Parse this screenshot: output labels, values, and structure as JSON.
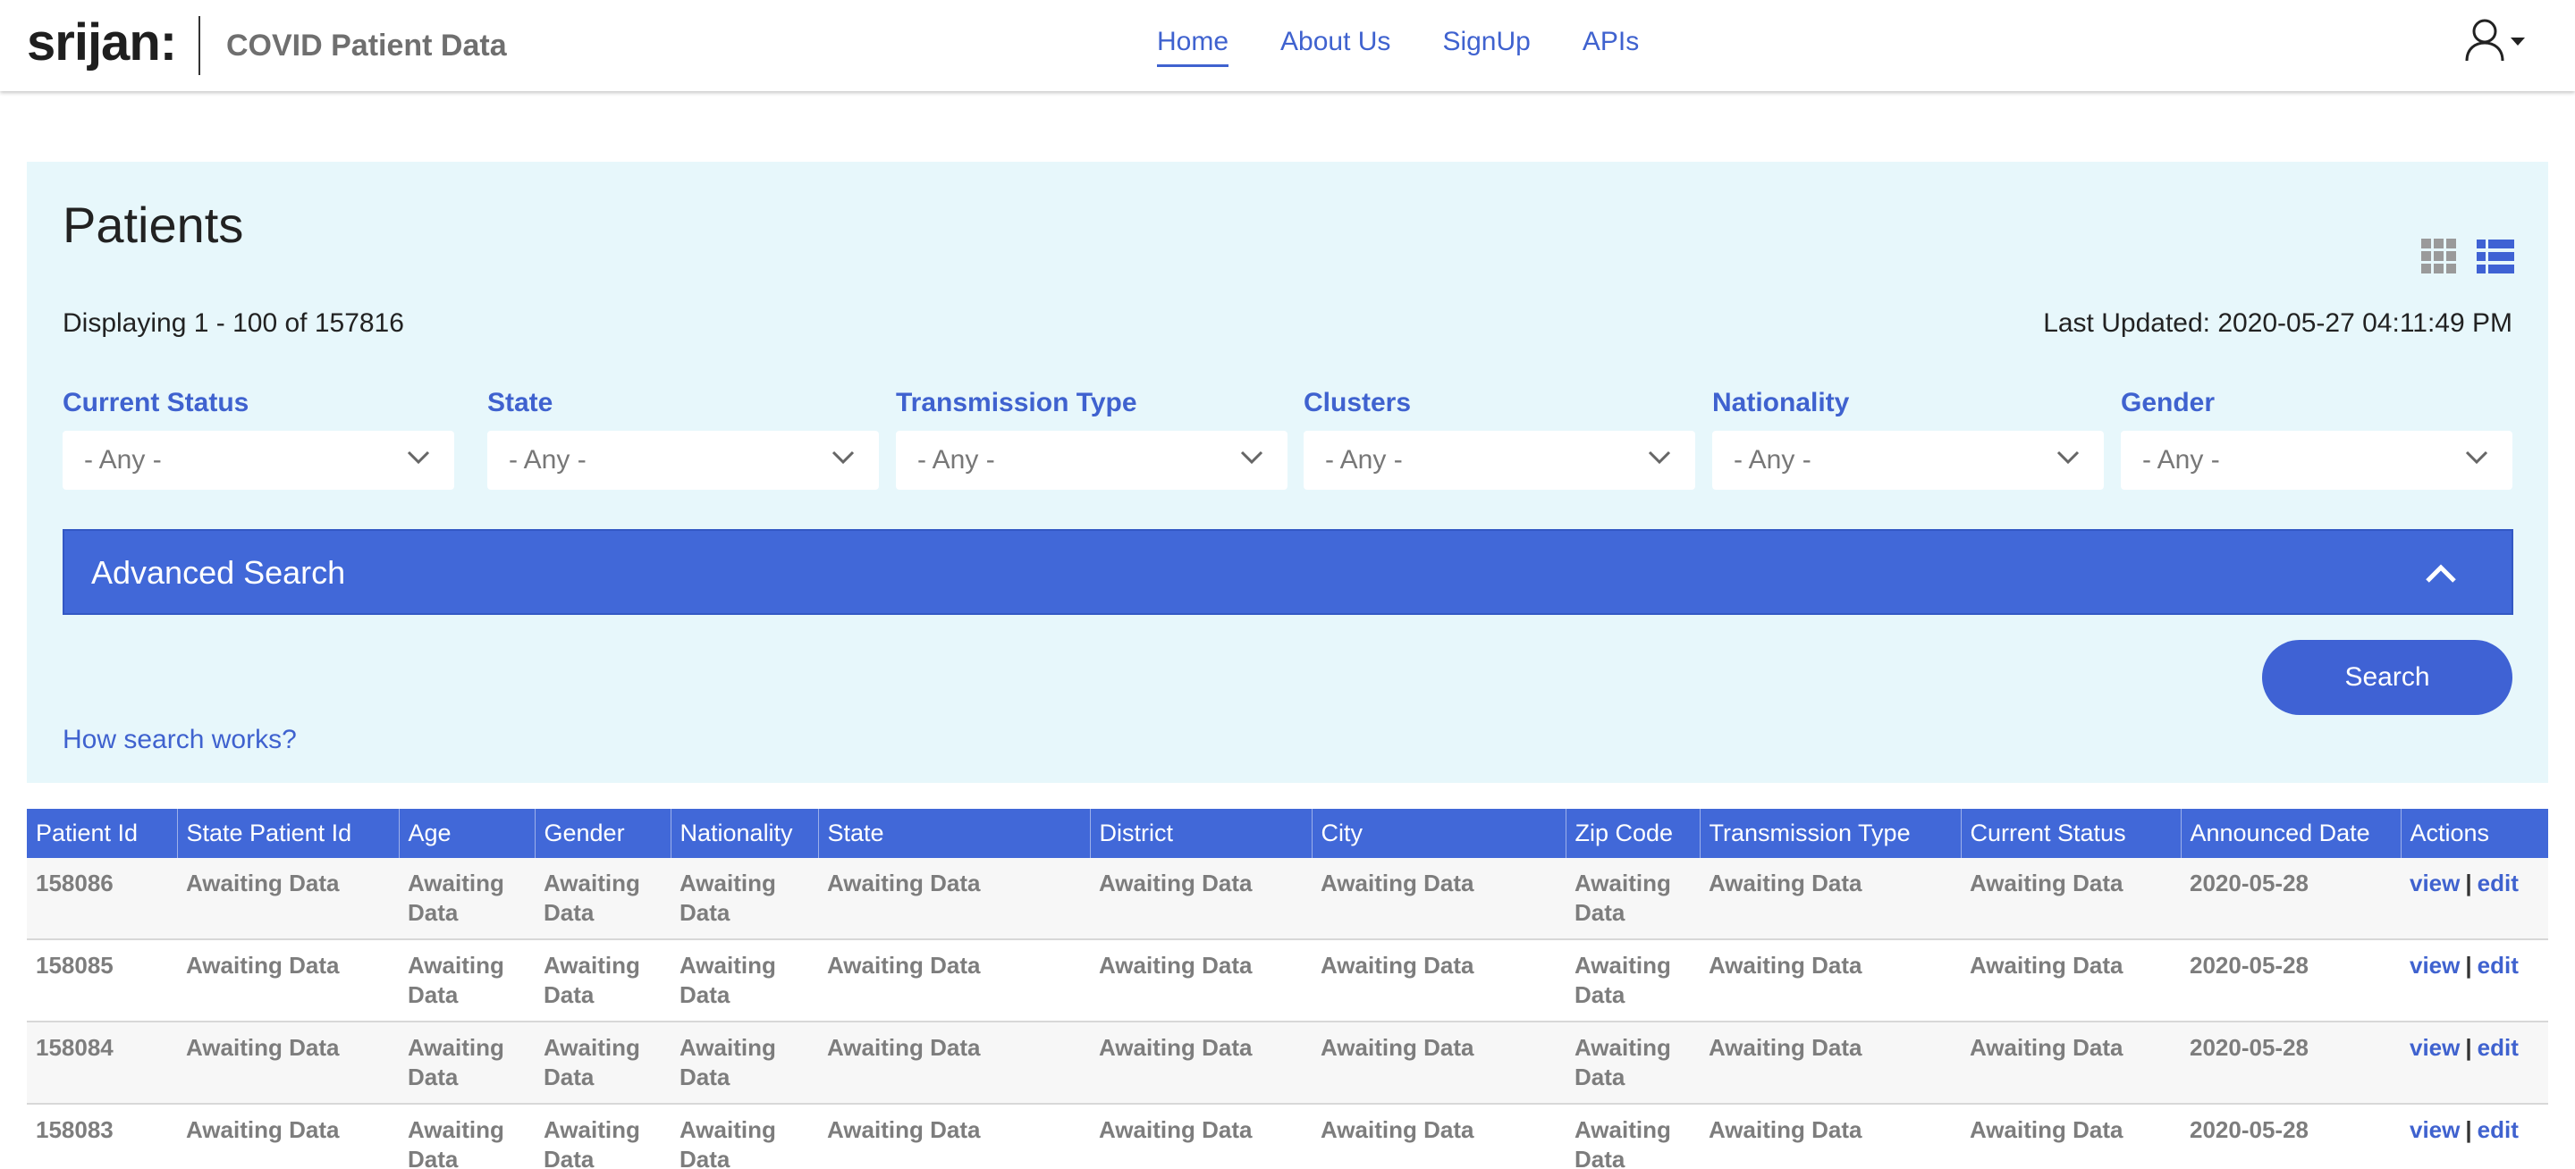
{
  "header": {
    "logo": "srijan:",
    "site_name": "COVID Patient Data",
    "nav": [
      "Home",
      "About Us",
      "SignUp",
      "APIs"
    ]
  },
  "panel": {
    "title": "Patients",
    "count_text": "Displaying 1 - 100 of 157816",
    "updated_text": "Last Updated: 2020-05-27 04:11:49 PM",
    "filters": [
      {
        "label": "Current Status",
        "value": "- Any -"
      },
      {
        "label": "State",
        "value": "- Any -"
      },
      {
        "label": "Transmission Type",
        "value": "- Any -"
      },
      {
        "label": "Clusters",
        "value": "- Any -"
      },
      {
        "label": "Nationality",
        "value": "- Any -"
      },
      {
        "label": "Gender",
        "value": "- Any -"
      }
    ],
    "advanced_search": "Advanced Search",
    "search_button": "Search",
    "how_link": "How search works?"
  },
  "table": {
    "columns": [
      "Patient Id",
      "State Patient Id",
      "Age",
      "Gender",
      "Nationality",
      "State",
      "District",
      "City",
      "Zip Code",
      "Transmission Type",
      "Current Status",
      "Announced Date",
      "Actions"
    ],
    "placeholder": "Awaiting Data",
    "action_view": "view",
    "action_sep": "|",
    "action_edit": "edit",
    "rows": [
      {
        "id": "158086",
        "date": "2020-05-28"
      },
      {
        "id": "158085",
        "date": "2020-05-28"
      },
      {
        "id": "158084",
        "date": "2020-05-28"
      },
      {
        "id": "158083",
        "date": "2020-05-28"
      }
    ]
  },
  "colors": {
    "accent": "#4168d8",
    "panel_bg": "#e7f7fb",
    "link": "#3f62cf"
  }
}
